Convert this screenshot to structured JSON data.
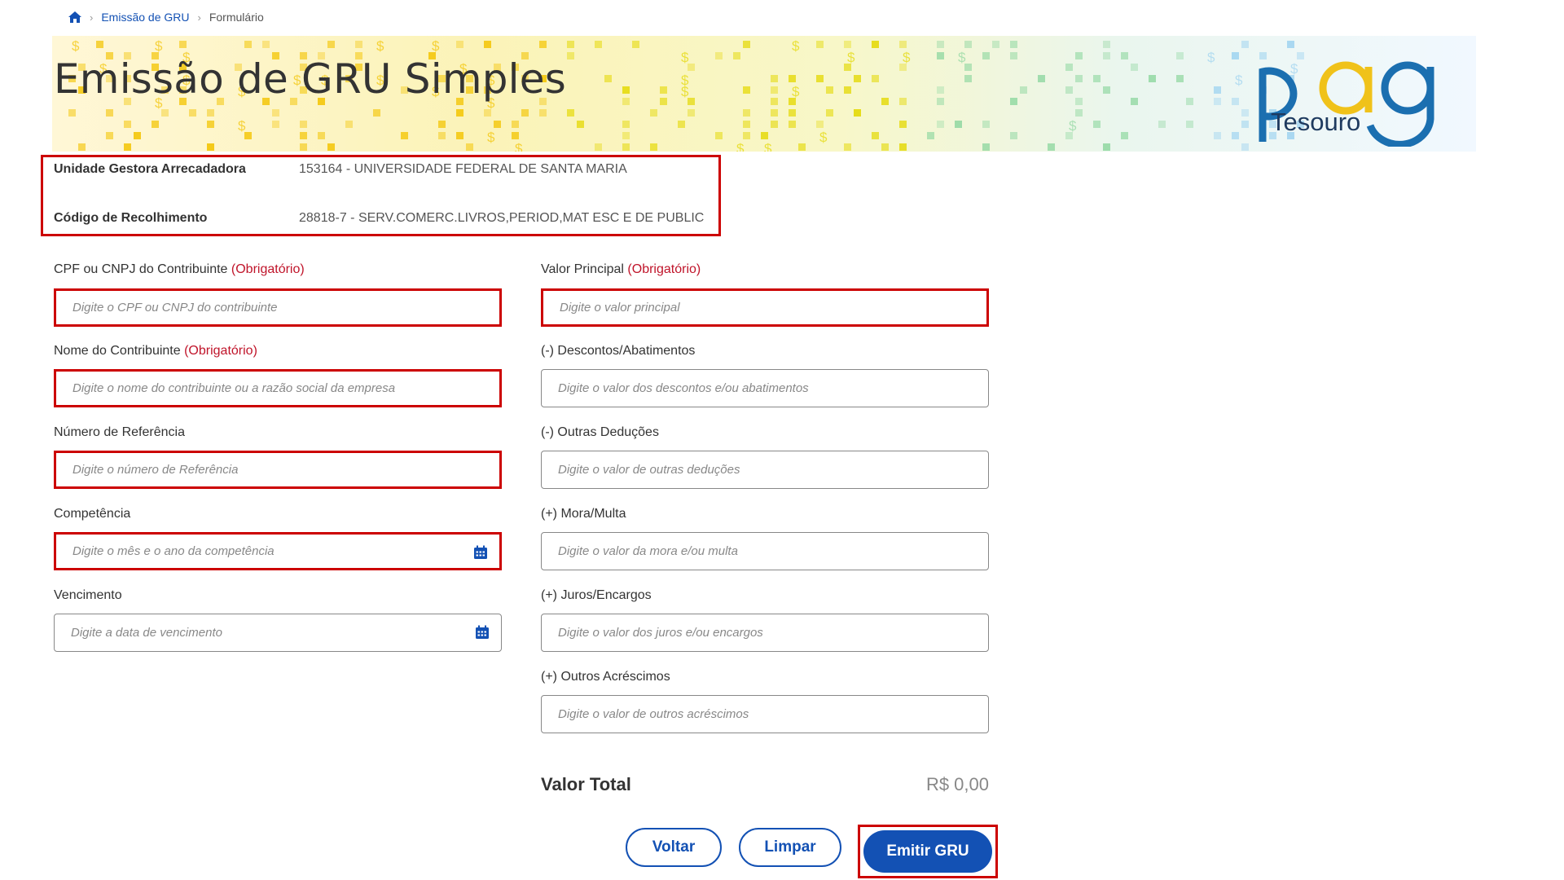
{
  "breadcrumb": {
    "items": [
      "Emissão de GRU",
      "Formulário"
    ]
  },
  "header": {
    "title": "Emissão de GRU Simples",
    "logo_text": "pag",
    "logo_subtext": "Tesouro"
  },
  "info": {
    "ug_label": "Unidade Gestora Arrecadadora",
    "ug_value": "153164 - UNIVERSIDADE FEDERAL DE SANTA MARIA",
    "codigo_label": "Código de Recolhimento",
    "codigo_value": "28818-7 - SERV.COMERC.LIVROS,PERIOD,MAT ESC E DE PUBLIC"
  },
  "form": {
    "required_tag": "(Obrigatório)",
    "left": [
      {
        "label": "CPF ou CNPJ do Contribuinte",
        "required": true,
        "placeholder": "Digite o CPF ou CNPJ do contribuinte"
      },
      {
        "label": "Nome do Contribuinte",
        "required": true,
        "placeholder": "Digite o nome do contribuinte ou a razão social da empresa"
      },
      {
        "label": "Número de Referência",
        "required": false,
        "placeholder": "Digite o número de Referência"
      },
      {
        "label": "Competência",
        "required": false,
        "placeholder": "Digite o mês e o ano da competência",
        "icon": "calendar-icon"
      },
      {
        "label": "Vencimento",
        "required": false,
        "placeholder": "Digite a data de vencimento",
        "icon": "calendar-icon"
      }
    ],
    "right": [
      {
        "label": "Valor Principal",
        "required": true,
        "placeholder": "Digite o valor principal"
      },
      {
        "label": "(-) Descontos/Abatimentos",
        "required": false,
        "placeholder": "Digite o valor dos descontos e/ou abatimentos"
      },
      {
        "label": "(-) Outras Deduções",
        "required": false,
        "placeholder": "Digite o valor de outras deduções"
      },
      {
        "label": "(+) Mora/Multa",
        "required": false,
        "placeholder": "Digite o valor da mora e/ou multa"
      },
      {
        "label": "(+) Juros/Encargos",
        "required": false,
        "placeholder": "Digite o valor dos juros e/ou encargos"
      },
      {
        "label": "(+) Outros Acréscimos",
        "required": false,
        "placeholder": "Digite o valor de outros acréscimos"
      }
    ],
    "total_label": "Valor Total",
    "total_value": "R$ 0,00"
  },
  "buttons": {
    "back": "Voltar",
    "clear": "Limpar",
    "emit": "Emitir GRU"
  },
  "colors": {
    "primary": "#1351b4",
    "required": "#c0142a",
    "highlight": "#cc0000"
  }
}
